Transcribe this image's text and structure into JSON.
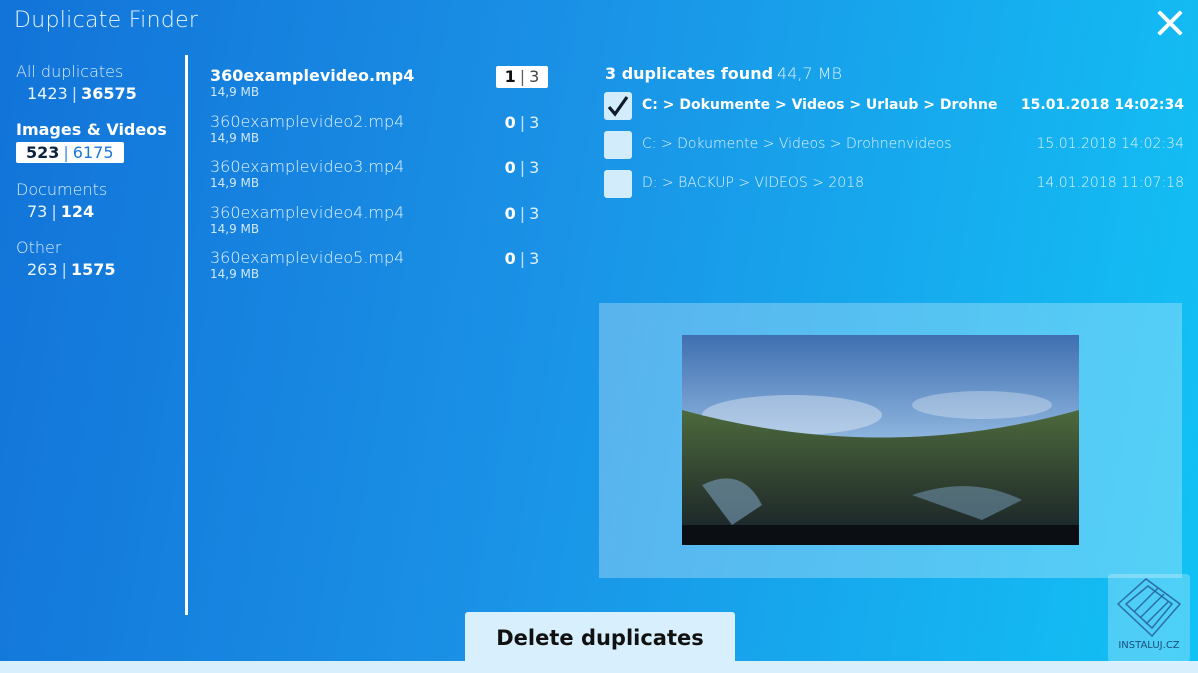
{
  "app": {
    "title": "Duplicate Finder"
  },
  "categories": [
    {
      "name": "All duplicates",
      "count_a": "1423",
      "count_b": "36575",
      "active": false
    },
    {
      "name": "Images & Videos",
      "count_a": "523",
      "count_b": "6175",
      "active": true
    },
    {
      "name": "Documents",
      "count_a": "73",
      "count_b": "124",
      "active": false
    },
    {
      "name": "Other",
      "count_a": "263",
      "count_b": "1575",
      "active": false
    }
  ],
  "files": [
    {
      "name": "360examplevideo.mp4",
      "size": "14,9 MB",
      "selected": "1",
      "total": "3"
    },
    {
      "name": "360examplevideo2.mp4",
      "size": "14,9 MB",
      "selected": "0",
      "total": "3"
    },
    {
      "name": "360examplevideo3.mp4",
      "size": "14,9 MB",
      "selected": "0",
      "total": "3"
    },
    {
      "name": "360examplevideo4.mp4",
      "size": "14,9 MB",
      "selected": "0",
      "total": "3"
    },
    {
      "name": "360examplevideo5.mp4",
      "size": "14,9 MB",
      "selected": "0",
      "total": "3"
    }
  ],
  "duplicates": {
    "header": "3 duplicates found",
    "size": "44,7 MB",
    "items": [
      {
        "path": "C: > Dokumente > Videos > Urlaub > Drohne",
        "date": "15.01.2018 14:02:34",
        "checked": true
      },
      {
        "path": "C: > Dokumente > Videos > Drohnenvideos",
        "date": "15.01.2018 14:02:34",
        "checked": false
      },
      {
        "path": "D: > BACKUP > VIDEOS > 2018",
        "date": "14.01.2018 11:07:18",
        "checked": false
      }
    ]
  },
  "actions": {
    "delete_label": "Delete duplicates"
  },
  "watermark": {
    "text": "INSTALUJ.CZ"
  },
  "icons": {
    "close": "close-icon",
    "check": "checkmark-icon"
  },
  "colors": {
    "accent": "#1a92e6",
    "panel_light": "#d8f0fd"
  }
}
